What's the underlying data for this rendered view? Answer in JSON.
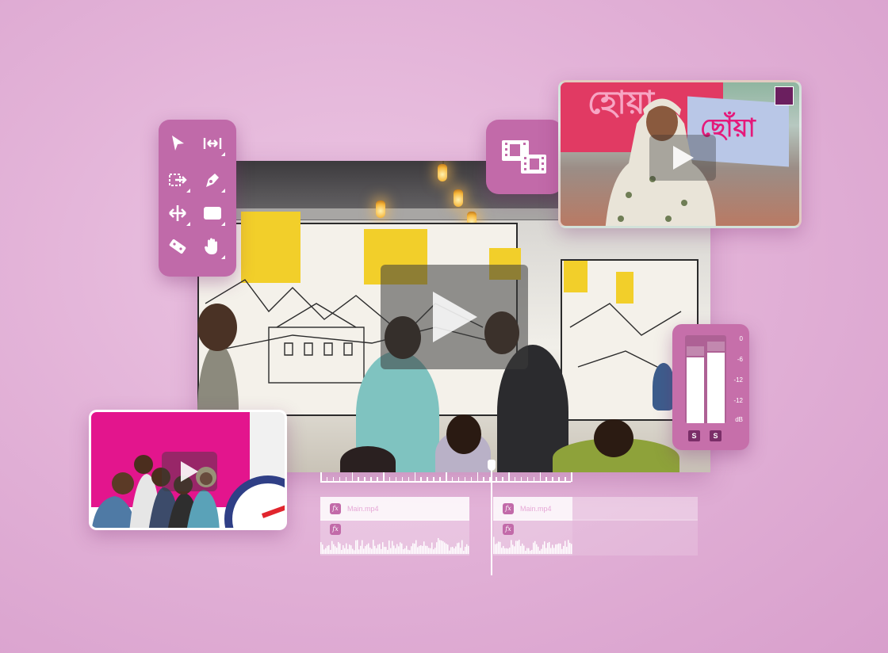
{
  "toolbar": {
    "tools": [
      {
        "name": "selection-tool-icon"
      },
      {
        "name": "ripple-trim-tool-icon"
      },
      {
        "name": "track-select-tool-icon"
      },
      {
        "name": "pen-tool-icon"
      },
      {
        "name": "slip-tool-icon"
      },
      {
        "name": "rectangle-tool-icon"
      },
      {
        "name": "razor-tool-icon"
      },
      {
        "name": "hand-tool-icon"
      }
    ]
  },
  "top_preview": {
    "banner_text_1": "হোয়া",
    "banner_text_2": "ছোঁয়া"
  },
  "audio_meter": {
    "scale": [
      "0",
      "-6",
      "-12",
      "-12",
      "dB"
    ],
    "left_level": 0.75,
    "right_level": 0.8,
    "solo_left": "S",
    "solo_right": "S"
  },
  "timeline": {
    "clips": [
      {
        "label": "Main.mp4"
      },
      {
        "label": "Main.mp4"
      }
    ],
    "fx_label": "fx"
  },
  "colors": {
    "accent": "#c26aa9",
    "background": "#e3b3d8",
    "magenta": "#e3158d"
  }
}
